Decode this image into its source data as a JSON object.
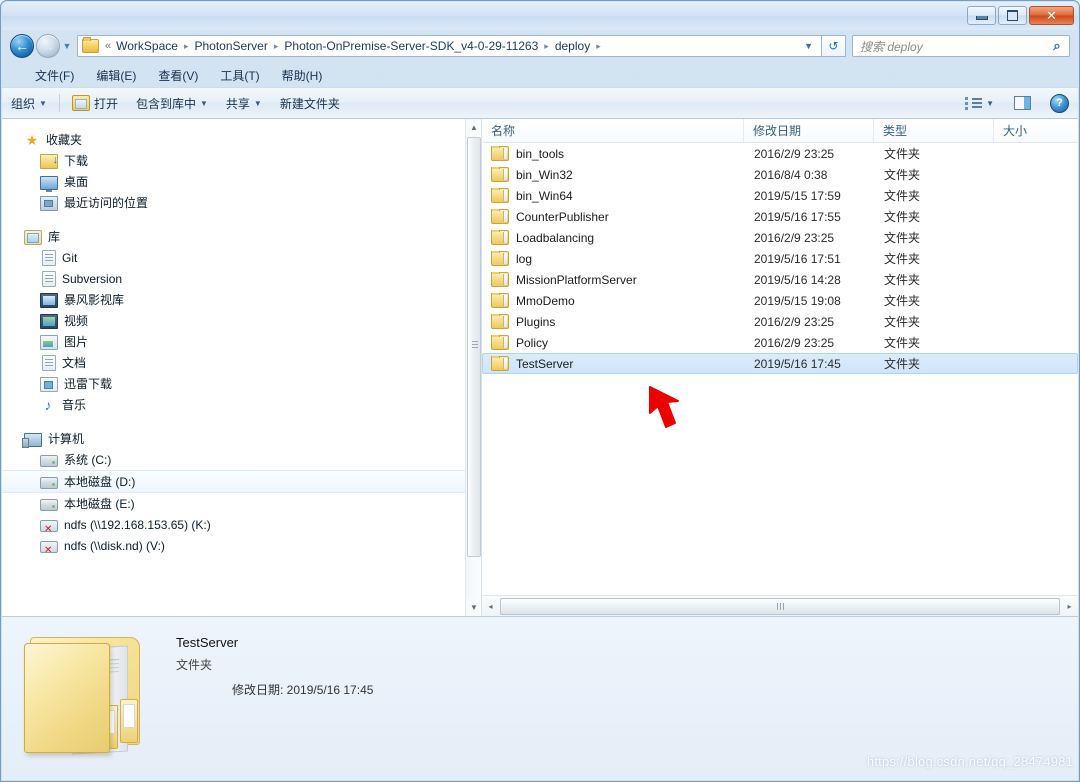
{
  "window": {
    "buttons": {
      "minimize": "–",
      "maximize": "□",
      "close": "✕"
    }
  },
  "nav": {
    "back_icon": "←",
    "forward_icon": "→",
    "history_caret": "▼",
    "refresh_icon": "↺",
    "breadcrumb": {
      "folder_icon": "folder-icon",
      "overflow": "«",
      "segments": [
        "WorkSpace",
        "PhotonServer",
        "Photon-OnPremise-Server-SDK_v4-0-29-11263",
        "deploy"
      ],
      "separator": "▸",
      "dropdown_caret": "▼"
    },
    "search": {
      "placeholder": "搜索 deploy",
      "value": "",
      "icon": "search-icon"
    }
  },
  "menubar": {
    "items": [
      {
        "label": "文件(F)"
      },
      {
        "label": "编辑(E)"
      },
      {
        "label": "查看(V)"
      },
      {
        "label": "工具(T)"
      },
      {
        "label": "帮助(H)"
      }
    ]
  },
  "toolbar": {
    "organize": "组织",
    "open": "打开",
    "include_in_library": "包含到库中",
    "share": "共享",
    "new_folder": "新建文件夹",
    "caret": "▼",
    "help_glyph": "?"
  },
  "sidebar": {
    "groups": [
      {
        "header": {
          "label": "收藏夹",
          "icon": "star-icon",
          "icon_class": "star",
          "glyph": "★"
        },
        "items": [
          {
            "label": "下载",
            "icon": "download-folder-icon",
            "icon_class": "download"
          },
          {
            "label": "桌面",
            "icon": "desktop-icon",
            "icon_class": "desktop"
          },
          {
            "label": "最近访问的位置",
            "icon": "recent-places-icon",
            "icon_class": "recent"
          }
        ]
      },
      {
        "header": {
          "label": "库",
          "icon": "library-icon",
          "icon_class": "lib",
          "glyph": ""
        },
        "items": [
          {
            "label": "Git",
            "icon": "git-library-icon",
            "icon_class": "git"
          },
          {
            "label": "Subversion",
            "icon": "subversion-library-icon",
            "icon_class": "svn"
          },
          {
            "label": "暴风影视库",
            "icon": "baofeng-library-icon",
            "icon_class": "movie"
          },
          {
            "label": "视频",
            "icon": "video-library-icon",
            "icon_class": "video"
          },
          {
            "label": "图片",
            "icon": "pictures-library-icon",
            "icon_class": "pic"
          },
          {
            "label": "文档",
            "icon": "documents-library-icon",
            "icon_class": "doc"
          },
          {
            "label": "迅雷下载",
            "icon": "thunder-download-icon",
            "icon_class": "xunlei"
          },
          {
            "label": "音乐",
            "icon": "music-library-icon",
            "icon_class": "music",
            "glyph": "♪"
          }
        ]
      },
      {
        "header": {
          "label": "计算机",
          "icon": "computer-icon",
          "icon_class": "computer",
          "glyph": ""
        },
        "items": [
          {
            "label": "系统 (C:)",
            "icon": "drive-icon",
            "icon_class": "drive"
          },
          {
            "label": "本地磁盘 (D:)",
            "icon": "drive-icon",
            "icon_class": "drive",
            "hover": true
          },
          {
            "label": "本地磁盘 (E:)",
            "icon": "drive-icon",
            "icon_class": "drive"
          },
          {
            "label": "ndfs (\\\\192.168.153.65) (K:)",
            "icon": "network-drive-disconnected-icon",
            "icon_class": "netdrive"
          },
          {
            "label": "ndfs (\\\\disk.nd) (V:)",
            "icon": "network-drive-disconnected-icon",
            "icon_class": "netdrive"
          }
        ]
      }
    ],
    "scrollbar": {
      "up": "▲",
      "down": "▼"
    }
  },
  "filelist": {
    "columns": [
      {
        "label": "名称",
        "key": "name",
        "sorted": "asc"
      },
      {
        "label": "修改日期",
        "key": "date"
      },
      {
        "label": "类型",
        "key": "type"
      },
      {
        "label": "大小",
        "key": "size"
      }
    ],
    "rows": [
      {
        "name": "bin_tools",
        "date": "2016/2/9 23:25",
        "type": "文件夹",
        "size": ""
      },
      {
        "name": "bin_Win32",
        "date": "2016/8/4 0:38",
        "type": "文件夹",
        "size": ""
      },
      {
        "name": "bin_Win64",
        "date": "2019/5/15 17:59",
        "type": "文件夹",
        "size": ""
      },
      {
        "name": "CounterPublisher",
        "date": "2019/5/16 17:55",
        "type": "文件夹",
        "size": ""
      },
      {
        "name": "Loadbalancing",
        "date": "2016/2/9 23:25",
        "type": "文件夹",
        "size": ""
      },
      {
        "name": "log",
        "date": "2019/5/16 17:51",
        "type": "文件夹",
        "size": ""
      },
      {
        "name": "MissionPlatformServer",
        "date": "2019/5/16 14:28",
        "type": "文件夹",
        "size": ""
      },
      {
        "name": "MmoDemo",
        "date": "2019/5/15 19:08",
        "type": "文件夹",
        "size": ""
      },
      {
        "name": "Plugins",
        "date": "2016/2/9 23:25",
        "type": "文件夹",
        "size": ""
      },
      {
        "name": "Policy",
        "date": "2016/2/9 23:25",
        "type": "文件夹",
        "size": ""
      },
      {
        "name": "TestServer",
        "date": "2019/5/16 17:45",
        "type": "文件夹",
        "size": "",
        "selected": true
      }
    ],
    "hscroll": {
      "left": "◂",
      "right": "▸"
    }
  },
  "details": {
    "name": "TestServer",
    "type": "文件夹",
    "modified_label": "修改日期: 2019/5/16 17:45",
    "icon": "large-folder-icon"
  },
  "annotation": {
    "arrow": "red-pointer-arrow"
  },
  "watermark": {
    "text": "https://blog.csdn.net/qq_28474981"
  },
  "colors": {
    "selection": "#cfe5f8",
    "accent": "#2f8fd4",
    "close_button": "#cf4715",
    "folder_yellow": "#efc95c",
    "annotation_red": "#ee0000"
  }
}
